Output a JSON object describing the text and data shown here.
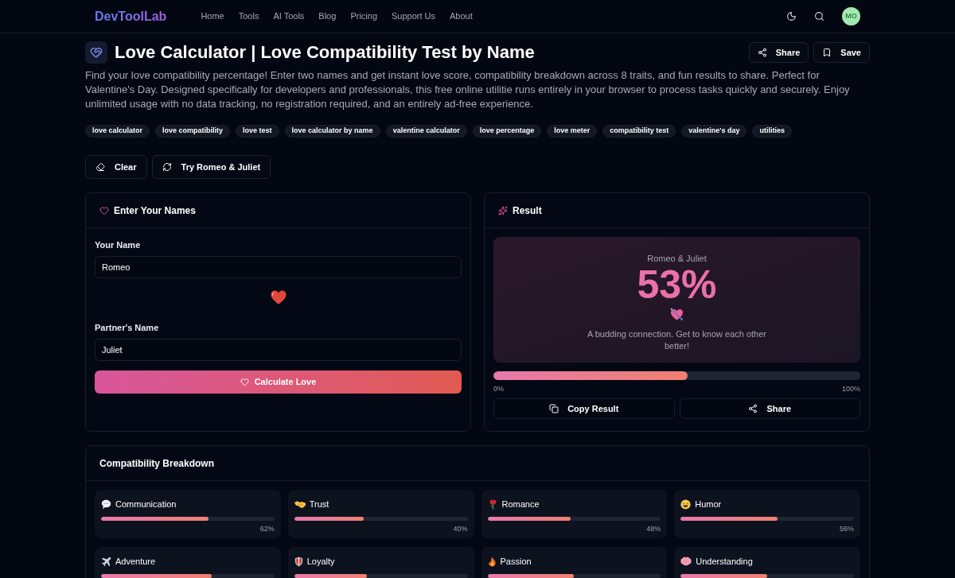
{
  "nav": {
    "logo": "DevToolLab",
    "links": [
      "Home",
      "Tools",
      "AI Tools",
      "Blog",
      "Pricing",
      "Support Us",
      "About"
    ],
    "avatar": "MO"
  },
  "header": {
    "title": "Love Calculator | Love Compatibility Test by Name",
    "actions": [
      "Share",
      "Save"
    ],
    "description": "Find your love compatibility percentage! Enter two names and get instant love score, compatibility breakdown across 8 traits, and fun results to share. Perfect for Valentine's Day. Designed specifically for developers and professionals, this free online utilitie runs entirely in your browser to process tasks quickly and securely. Enjoy unlimited usage with no data tracking, no registration required, and an entirely ad-free experience.",
    "tags": [
      "love calculator",
      "love compatibility",
      "love test",
      "love calculator by name",
      "valentine calculator",
      "love percentage",
      "love meter",
      "compatibility test",
      "valentine's day",
      "utilities"
    ]
  },
  "toolbar": [
    "Clear",
    "Try Romeo & Juliet"
  ],
  "input_card": {
    "title": "Enter Your Names",
    "fields": [
      {
        "label": "Your Name",
        "value": "Romeo"
      },
      {
        "label": "Partner's Name",
        "value": "Juliet"
      }
    ],
    "button": "Calculate Love"
  },
  "result_card": {
    "title": "Result",
    "names": "Romeo & Juliet",
    "score": "53%",
    "message": "A budding connection. Get to know each other better!",
    "level": 0.53,
    "scale_min": "0%",
    "scale_max": "100%",
    "buttons": [
      "Copy Result",
      "Share"
    ]
  },
  "breakdown": {
    "title": "Compatibility Breakdown",
    "traits": [
      {
        "name": "Communication",
        "level": 0.62,
        "reading": "62%"
      },
      {
        "name": "Trust",
        "level": 0.4,
        "reading": "40%"
      },
      {
        "name": "Romance",
        "level": 0.48,
        "reading": "48%"
      },
      {
        "name": "Humor",
        "level": 0.56,
        "reading": "56%"
      },
      {
        "name": "Adventure",
        "level": 0.64
      },
      {
        "name": "Loyalty",
        "level": 0.42
      },
      {
        "name": "Passion",
        "level": 0.5
      },
      {
        "name": "Understanding",
        "level": 0.5
      }
    ]
  }
}
